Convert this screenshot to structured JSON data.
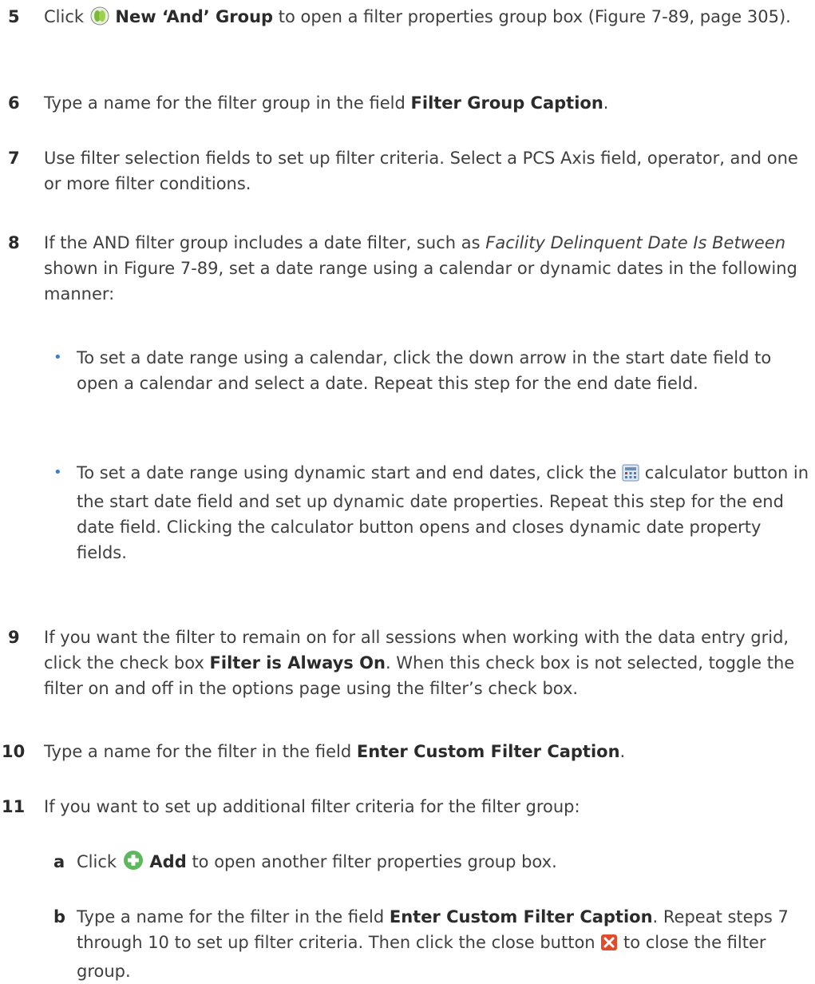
{
  "steps": [
    {
      "num": "5",
      "pre": "Click",
      "icon": "new-and-group-icon",
      "bold": "New ‘And’ Group",
      "post": "to open a filter properties group box (Figure 7-89, page 305)."
    },
    {
      "num": "6",
      "pre": "Type a name for the filter group in the field",
      "bold": "Filter Group Caption",
      "post": "."
    },
    {
      "num": "7",
      "text": "Use filter selection fields to set up filter criteria. Select a PCS Axis field, operator, and one or more filter conditions."
    },
    {
      "num": "8",
      "pre": "If the AND filter group includes a date filter, such as",
      "italic": "Facility Delinquent Date Is Between",
      "post": "shown in Figure 7-89, set a date range using a calendar or dynamic dates in the following manner:",
      "bullets": [
        {
          "text": "To set a date range using a calendar, click the down arrow in the start date field to open a calendar and select a date. Repeat this step for the end date field."
        },
        {
          "pre": "To set a date range using dynamic start and end dates, click the",
          "icon": "calculator-icon",
          "post": "calculator button in the start date field and set up dynamic date properties. Repeat this step for the end date field. Clicking the calculator button opens and closes dynamic date property fields."
        }
      ]
    },
    {
      "num": "9",
      "pre": "If you want the filter to remain on for all sessions when working with the data entry grid, click the check box",
      "bold": "Filter is Always On",
      "post": ". When this check box is not selected, toggle the filter on and off in the options page using the filter’s check box."
    },
    {
      "num": "10",
      "pre": "Type a name for the filter in the field",
      "bold": "Enter Custom Filter Caption",
      "post": "."
    },
    {
      "num": "11",
      "text": "If you want to set up additional filter criteria for the filter group:",
      "substeps": [
        {
          "letter": "a",
          "pre": "Click",
          "icon": "add-icon",
          "bold": "Add",
          "post": "to open another filter properties group box."
        },
        {
          "letter": "b",
          "pre": "Type a name for the filter in the field",
          "bold": "Enter Custom Filter Caption",
          "mid": ". Repeat steps 7 through 10 to set up filter criteria. Then click the close button",
          "icon": "close-icon",
          "post": "to close the filter group."
        }
      ]
    }
  ],
  "colors": {
    "text": "#3f3f3f",
    "bullet": "#3b7fc4",
    "add_icon": "#5cb85c",
    "close_icon": "#e04b2e",
    "group_icon": "#7ab83a"
  }
}
